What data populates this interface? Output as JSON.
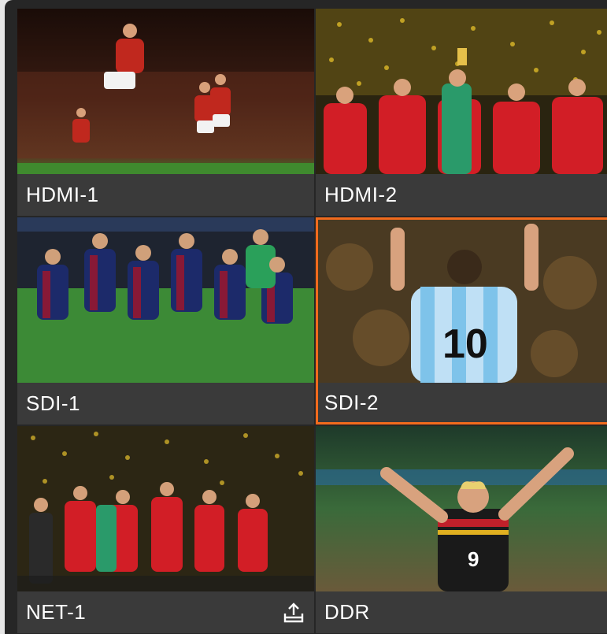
{
  "sources": [
    {
      "label": "HDMI-1",
      "selected": false
    },
    {
      "label": "HDMI-2",
      "selected": false
    },
    {
      "label": "SDI-1",
      "selected": false
    },
    {
      "label": "SDI-2",
      "selected": true
    },
    {
      "label": "NET-1",
      "selected": false,
      "icon": "upload-icon"
    },
    {
      "label": "DDR",
      "selected": false
    }
  ],
  "colors": {
    "selected_border": "#f26b1d",
    "panel_bg": "#262626",
    "label_bg": "#3a3a3a"
  }
}
